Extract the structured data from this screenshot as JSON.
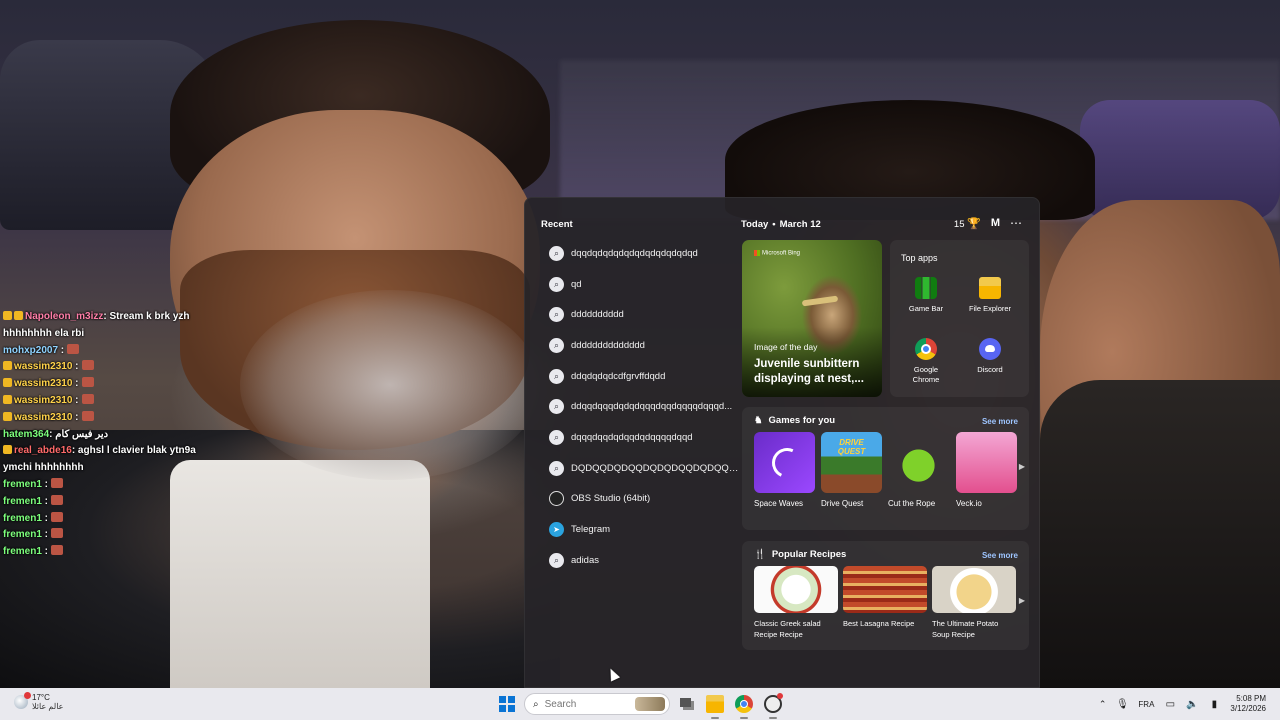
{
  "chat": [
    {
      "user": "Napoleon_m3izz",
      "message": ": Stream k brk yzh hhhhhhhh ela rbi",
      "color": "#ff7ea8",
      "badges": 2,
      "emote": false
    },
    {
      "user": "mohxp2007",
      "message": " :",
      "color": "#8fd3ff",
      "badges": 0,
      "emote": true
    },
    {
      "user": "wassim2310",
      "message": " :",
      "color": "#ffd24a",
      "badges": 1,
      "emote": true
    },
    {
      "user": "wassim2310",
      "message": " :",
      "color": "#ffd24a",
      "badges": 1,
      "emote": true
    },
    {
      "user": "wassim2310",
      "message": " :",
      "color": "#ffd24a",
      "badges": 1,
      "emote": true
    },
    {
      "user": "wassim2310",
      "message": " :",
      "color": "#ffd24a",
      "badges": 1,
      "emote": true
    },
    {
      "user": "hatem364",
      "message": ": دير فيس كام",
      "color": "#7dff7d",
      "badges": 0,
      "emote": false
    },
    {
      "user": "real_abde16",
      "message": ": aghsl l clavier blak ytn9a ymchi hhhhhhhh",
      "color": "#ff6a6a",
      "badges": 1,
      "emote": false
    },
    {
      "user": "fremen1",
      "message": " :",
      "color": "#7dff7d",
      "badges": 0,
      "emote": true
    },
    {
      "user": "fremen1",
      "message": " :",
      "color": "#7dff7d",
      "badges": 0,
      "emote": true
    },
    {
      "user": "fremen1",
      "message": " :",
      "color": "#7dff7d",
      "badges": 0,
      "emote": true
    },
    {
      "user": "fremen1",
      "message": " :",
      "color": "#7dff7d",
      "badges": 0,
      "emote": true
    },
    {
      "user": "fremen1",
      "message": " :",
      "color": "#7dff7d",
      "badges": 0,
      "emote": true
    }
  ],
  "flyout": {
    "recent_title": "Recent",
    "recent": [
      {
        "text": "dqqdqdqdqdqdqdqdqdqdqdqd",
        "icon": "search-icon"
      },
      {
        "text": "qd",
        "icon": "search-icon"
      },
      {
        "text": "dddddddddd",
        "icon": "search-icon"
      },
      {
        "text": "dddddddddddddd",
        "icon": "search-icon"
      },
      {
        "text": "ddqdqdqdcdfgrvffdqdd",
        "icon": "search-icon"
      },
      {
        "text": "ddqqdqqqdqdqdqqqdqqdqqqqdqqqd...",
        "icon": "search-icon"
      },
      {
        "text": "dqqqdqqdqdqqdqdqqqqdqqd",
        "icon": "search-icon"
      },
      {
        "text": "DQDQQDQDQQDQDQDQQDQDQQDQ...",
        "icon": "search-icon"
      },
      {
        "text": "OBS Studio (64bit)",
        "icon": "obs-icon"
      },
      {
        "text": "Telegram",
        "icon": "telegram-icon"
      },
      {
        "text": "adidas",
        "icon": "search-icon"
      }
    ],
    "today": "Today",
    "date": "March 12",
    "rewards_points": "15",
    "profile_initial": "M",
    "more": "⋯",
    "image_of_day": {
      "brand": "Microsoft Bing",
      "caption": "Image of the day",
      "headline": "Juvenile sunbittern displaying at nest,..."
    },
    "top_apps": {
      "title": "Top apps",
      "apps": [
        {
          "label": "Game Bar",
          "icon": "game-bar-icon"
        },
        {
          "label": "File Explorer",
          "icon": "file-explorer-icon"
        },
        {
          "label": "Google Chrome",
          "icon": "chrome-icon"
        },
        {
          "label": "Discord",
          "icon": "discord-icon"
        }
      ]
    },
    "games": {
      "title": "Games for you",
      "see_more": "See more",
      "items": [
        "Space Waves",
        "Drive Quest",
        "Cut the Rope",
        "Veck.io"
      ]
    },
    "recipes": {
      "title": "Popular Recipes",
      "see_more": "See more",
      "items": [
        "Classic Greek salad Recipe Recipe",
        "Best Lasagna Recipe",
        "The Ultimate Potato Soup Recipe"
      ]
    }
  },
  "taskbar": {
    "weather_temp": "17°C",
    "weather_cond": "عالم عائلا",
    "search_placeholder": "Search",
    "language": "FRA",
    "time": "5:08 PM",
    "date": "3/12/2026"
  }
}
